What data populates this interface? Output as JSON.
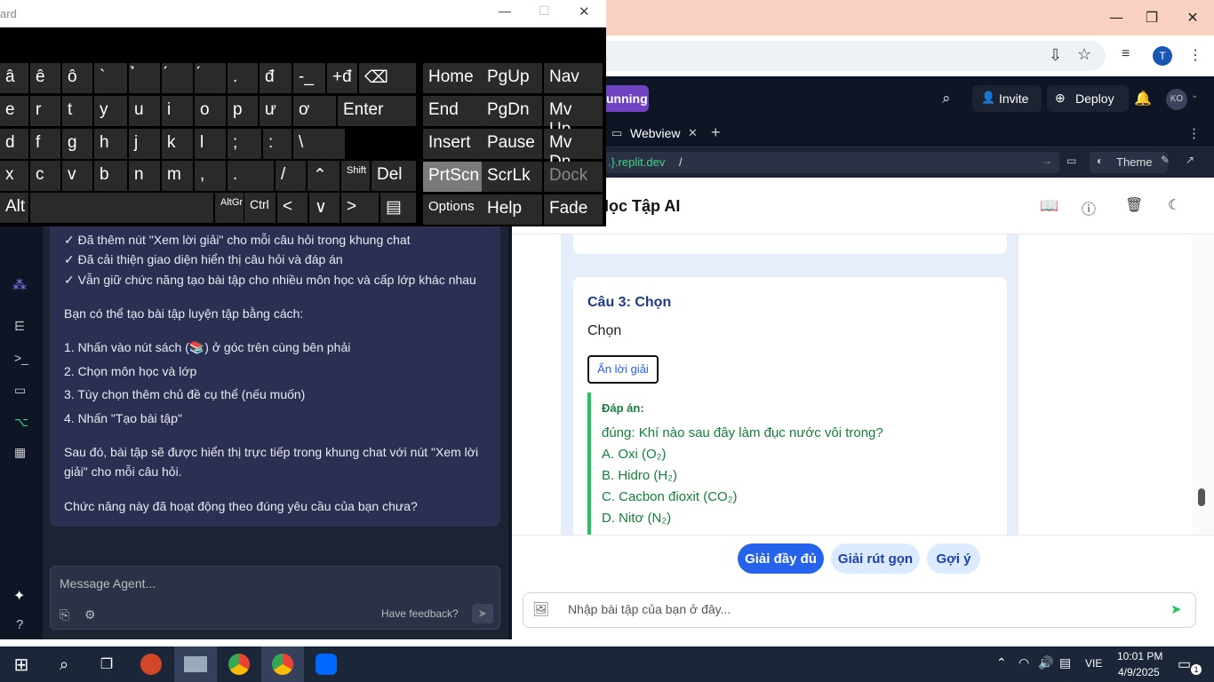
{
  "osk": {
    "title": "ard",
    "rows": [
      [
        "â",
        "ê",
        "ô",
        "`",
        "̉",
        "́",
        "́",
        ".",
        "đ",
        "-_",
        "+đ",
        "⌫"
      ],
      [
        "e",
        "r",
        "t",
        "y",
        "u",
        "i",
        "o",
        "p",
        "ư",
        "ơ",
        "Enter"
      ],
      [
        "d",
        "f",
        "g",
        "h",
        "j",
        "k",
        "l",
        ";",
        ":",
        "\\"
      ],
      [
        "x",
        "c",
        "v",
        "b",
        "n",
        "m",
        ",",
        ".",
        "/",
        "⌃",
        "Shift",
        "Del"
      ],
      [
        "Alt",
        "",
        "AltGr",
        "Ctrl",
        "<",
        "∨",
        ">",
        "▤"
      ]
    ],
    "nav": [
      "Home",
      "PgUp",
      "Nav",
      "End",
      "PgDn",
      "Mv Up",
      "Insert",
      "Pause",
      "Mv Dn",
      "PrtScn",
      "ScrLk",
      "Dock",
      "Options",
      "Help",
      "Fade"
    ]
  },
  "chrome": {
    "profile_initial": "T"
  },
  "replit": {
    "running": "unning",
    "invite": "Invite",
    "deploy": "Deploy",
    "avatar": "KO",
    "tab_webview": "Webview",
    "url_host": ".}.replit.dev",
    "url_path": "/",
    "theme": "Theme"
  },
  "agent": {
    "lines": [
      "✓ Đã thêm nút \"Xem lời giải\" cho mỗi câu hỏi trong khung chat",
      "✓ Đã cải thiện giao diện hiển thị câu hỏi và đáp án",
      "✓ Vẫn giữ chức năng tạo bài tập cho nhiều môn học và cấp lớp khác nhau",
      "Bạn có thể tạo bài tập luyện tập bằng cách:",
      "1. Nhấn vào nút sách (📚) ở góc trên cùng bên phải",
      "2. Chọn môn học và lớp",
      "3. Tùy chọn thêm chủ đề cụ thể (nếu muốn)",
      "4. Nhấn \"Tạo bài tập\"",
      "Sau đó, bài tập sẽ được hiển thị trực tiếp trong khung chat với nút \"Xem lời",
      "giải\" cho mỗi câu hỏi.",
      "Chức năng này đã hoạt động theo đúng yêu cầu của bạn chưa?"
    ],
    "input_placeholder": "Message Agent...",
    "feedback": "Have feedback?"
  },
  "app": {
    "title": "Học Tập AI",
    "question_title": "Câu 3: Chọn",
    "question_text": "Chọn",
    "hide_answer": "Ẩn lời giải",
    "answer_label": "Đáp án:",
    "answer_lines": [
      "đúng: Khí nào sau đây làm đục nước vôi trong?",
      "A. Oxi (O₂)",
      "B. Hidro (H₂)",
      "C. Cacbon đioxit (CO₂)",
      "D. Nitơ (N₂)"
    ],
    "chips": [
      "Giải đầy đủ",
      "Giải rút gọn",
      "Gợi ý"
    ],
    "input_placeholder": "Nhập bài tập của bạn ở đây..."
  },
  "taskbar": {
    "lang": "VIE",
    "time": "10:01 PM",
    "date": "4/9/2025",
    "notif": "1"
  }
}
